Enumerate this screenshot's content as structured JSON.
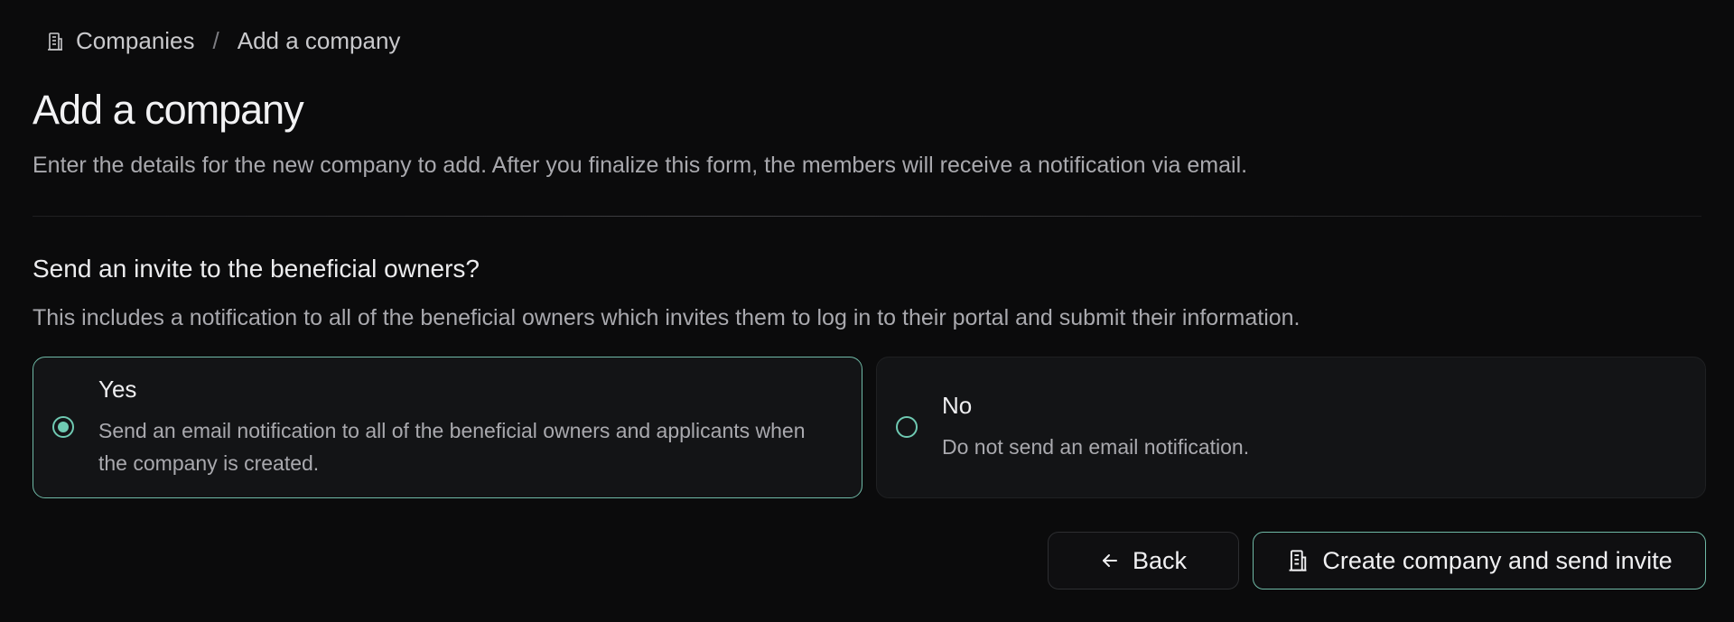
{
  "breadcrumb": {
    "icon": "building-icon",
    "parent": "Companies",
    "separator": "/",
    "current": "Add a company"
  },
  "header": {
    "title": "Add a company",
    "subtitle": "Enter the details for the new company to add. After you finalize this form, the members will receive a notification via email."
  },
  "invite_section": {
    "title": "Send an invite to the beneficial owners?",
    "description": "This includes a notification to all of the beneficial owners which invites them to log in to their portal and submit their information.",
    "selected": "yes",
    "options": [
      {
        "id": "yes",
        "label": "Yes",
        "description": "Send an email notification to all of the beneficial owners and applicants when the company is created."
      },
      {
        "id": "no",
        "label": "No",
        "description": "Do not send an email notification."
      }
    ]
  },
  "actions": {
    "back_label": "Back",
    "back_icon": "arrow-left-icon",
    "create_label": "Create company and send invite",
    "create_icon": "building-icon"
  },
  "colors": {
    "background": "#0b0b0c",
    "accent": "#6fc9b2",
    "card": "#131416"
  }
}
